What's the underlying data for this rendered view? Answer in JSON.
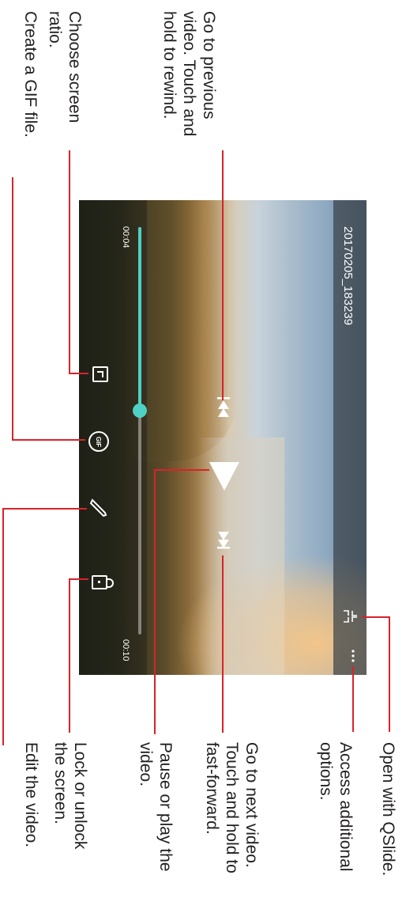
{
  "annotations": {
    "prev_video": "Go to previous\nvideo. Touch and\nhold to rewind.",
    "screen_ratio": "Choose screen\nratio.",
    "gif": "Create a GIF file.",
    "qslide": "Open with QSlide.",
    "more_options": "Access additional\noptions.",
    "next_video": "Go to next video.\nTouch and hold to\nfast-forward.",
    "play_pause": "Pause or play the\nvideo.",
    "lock": "Lock or unlock\nthe screen.",
    "edit": "Edit the video."
  },
  "player": {
    "file_name": "20170205_183239",
    "time_elapsed": "00:04",
    "time_total": "00:10",
    "progress": 0.45,
    "gif_label": "GIF",
    "accent_color": "#4fd1c5"
  },
  "icons": {
    "more": "more-vert-icon",
    "qslide": "qslide-icon",
    "rewind": "previous-icon",
    "play": "play-icon",
    "forward": "next-icon",
    "ratio": "screen-ratio-icon",
    "gif": "gif-icon",
    "edit": "pencil-icon",
    "lock": "lock-icon"
  },
  "colors": {
    "callout_line": "#d8232a"
  }
}
